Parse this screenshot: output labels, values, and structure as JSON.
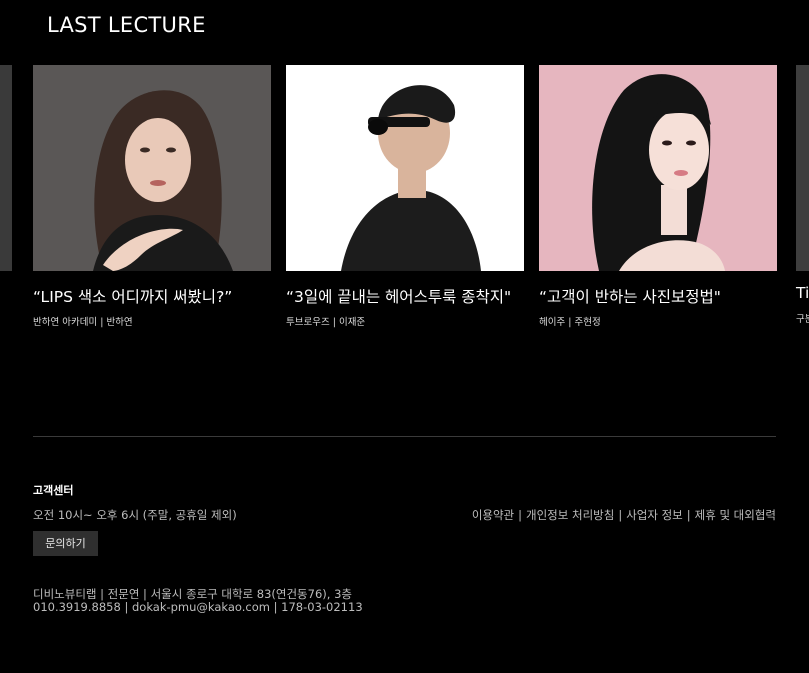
{
  "section": {
    "title": "LAST LECTURE"
  },
  "cards": [
    {
      "title": "“LIPS 색소 어디까지 써봤니?”",
      "academy": "반하연 아카데미",
      "instructor": "반하연"
    },
    {
      "title": "“3일에 끝내는 헤어스투룩 종착지\"",
      "academy": "투브로우즈",
      "instructor": "이재준"
    },
    {
      "title": "“고객이 반하는 사진보정법\"",
      "academy": "헤이주",
      "instructor": "주현정"
    }
  ],
  "partial_card": {
    "title": "Ti",
    "meta": "구분"
  },
  "footer": {
    "cs_title": "고객센터",
    "cs_hours": "오전 10시~ 오후 6시 (주말, 공휴일 제외)",
    "inquiry_label": "문의하기",
    "links": [
      "이용약관",
      "개인정보 처리방침",
      "사업자 정보",
      "제휴 및 대외협력"
    ],
    "company_line1": "디비노뷰티랩 | 전문연 | 서울시 종로구 대학로 83(연건동76), 3층",
    "company_line2": "010.3919.8858 | dokak-pmu@kakao.com | 178-03-02113"
  },
  "colors": {
    "background": "#000000",
    "card1_bg": "#5a5756",
    "card2_bg": "#ffffff",
    "card3_bg": "#e6b6bf"
  }
}
